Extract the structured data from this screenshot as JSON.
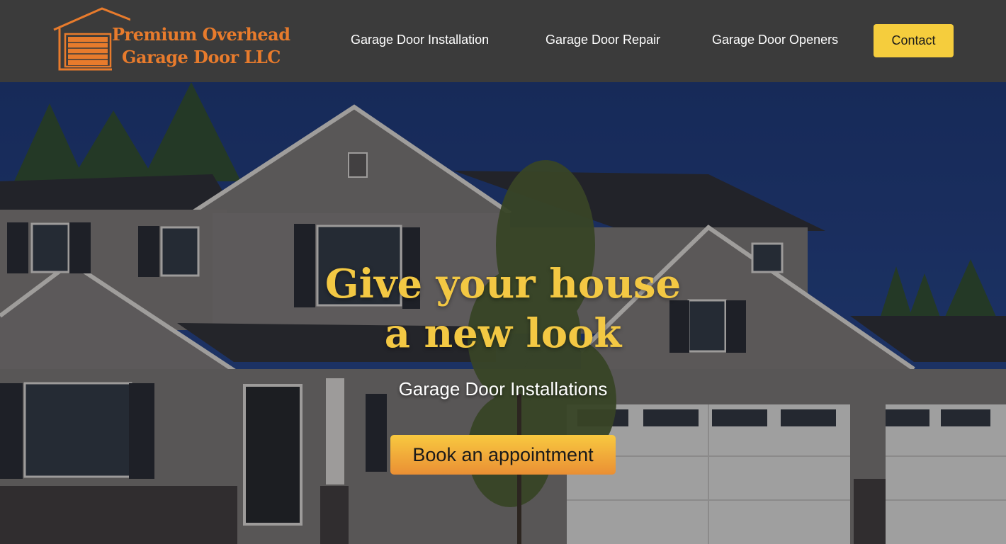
{
  "brand": {
    "name_line1": "Premium Overhead",
    "name_line2": "Garage Door LLC",
    "logo_color": "#e87b2c"
  },
  "nav": {
    "items": [
      {
        "label": "Garage Door Installation"
      },
      {
        "label": "Garage Door Repair"
      },
      {
        "label": "Garage Door Openers"
      }
    ],
    "contact_label": "Contact",
    "contact_color": "#f5cd3d"
  },
  "hero": {
    "title_line1": "Give your house",
    "title_line2": "a new look",
    "subtitle": "Garage Door Installations",
    "cta_label": "Book an appointment",
    "title_color": "#f3c843"
  }
}
